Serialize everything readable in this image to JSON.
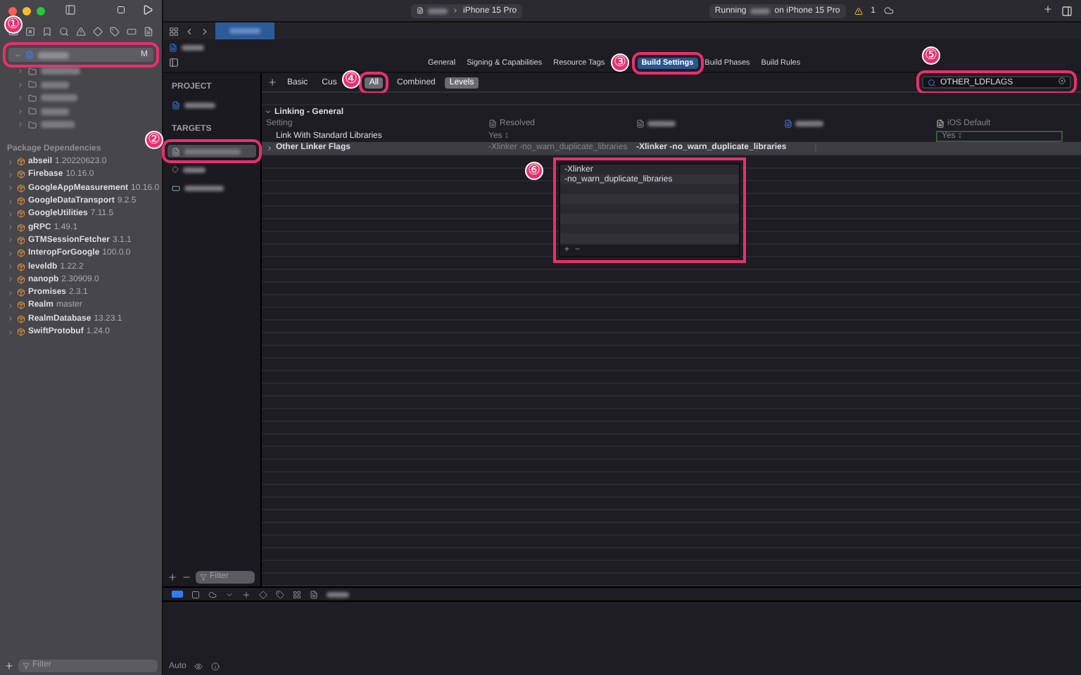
{
  "navigator": {
    "project_badge": "M",
    "packages_heading": "Package Dependencies",
    "packages": [
      {
        "name": "abseil",
        "version": "1.20220623.0"
      },
      {
        "name": "Firebase",
        "version": "10.16.0"
      },
      {
        "name": "GoogleAppMeasurement",
        "version": "10.16.0"
      },
      {
        "name": "GoogleDataTransport",
        "version": "9.2.5"
      },
      {
        "name": "GoogleUtilities",
        "version": "7.11.5"
      },
      {
        "name": "gRPC",
        "version": "1.49.1"
      },
      {
        "name": "GTMSessionFetcher",
        "version": "3.1.1"
      },
      {
        "name": "InteropForGoogle",
        "version": "100.0.0"
      },
      {
        "name": "leveldb",
        "version": "1.22.2"
      },
      {
        "name": "nanopb",
        "version": "2.30909.0"
      },
      {
        "name": "Promises",
        "version": "2.3.1"
      },
      {
        "name": "Realm",
        "version": "master"
      },
      {
        "name": "RealmDatabase",
        "version": "13.23.1"
      },
      {
        "name": "SwiftProtobuf",
        "version": "1.24.0"
      }
    ],
    "filter_placeholder": "Filter"
  },
  "toolbar": {
    "device": "iPhone 15 Pro",
    "status_prefix": "Running",
    "status_suffix": "on iPhone 15 Pro",
    "warning_count": "1"
  },
  "editor_tabs": [
    {
      "label": "General",
      "selected": false
    },
    {
      "label": "Signing & Capabilities",
      "selected": false
    },
    {
      "label": "Resource Tags",
      "selected": false
    },
    {
      "label": "Build Settings",
      "selected": true
    },
    {
      "label": "Build Phases",
      "selected": false
    },
    {
      "label": "Build Rules",
      "selected": false
    }
  ],
  "targets_panel": {
    "project_heading": "PROJECT",
    "targets_heading": "TARGETS",
    "filter_placeholder": "Filter"
  },
  "scope_filters": [
    {
      "label": "Basic",
      "selected": false
    },
    {
      "label": "Cus",
      "selected": false
    },
    {
      "label": "All",
      "selected": true
    },
    {
      "label": "Combined",
      "selected": false
    },
    {
      "label": "Levels",
      "selected": true
    }
  ],
  "search": {
    "value": "OTHER_LDFLAGS"
  },
  "section": {
    "title": "Linking - General",
    "expanded": true
  },
  "columns": {
    "setting": "Setting",
    "resolved": "Resolved",
    "default": "iOS Default"
  },
  "rows": [
    {
      "name": "Link With Standard Libraries",
      "resolved": "Yes ↕",
      "default": "Yes ↕",
      "selected": false
    },
    {
      "name": "Other Linker Flags",
      "resolved": "-Xlinker -no_warn_duplicate_libraries",
      "target": "-Xlinker -no_warn_duplicate_libraries",
      "selected": true
    }
  ],
  "popup": {
    "items": [
      "-Xlinker",
      "-no_warn_duplicate_libraries"
    ],
    "add": "+",
    "remove": "−"
  },
  "debug_bar": {
    "console_visible": true
  },
  "status_bar": {
    "mode": "Auto"
  },
  "callouts": [
    "①",
    "②",
    "③",
    "④",
    "⑤",
    "⑥"
  ]
}
